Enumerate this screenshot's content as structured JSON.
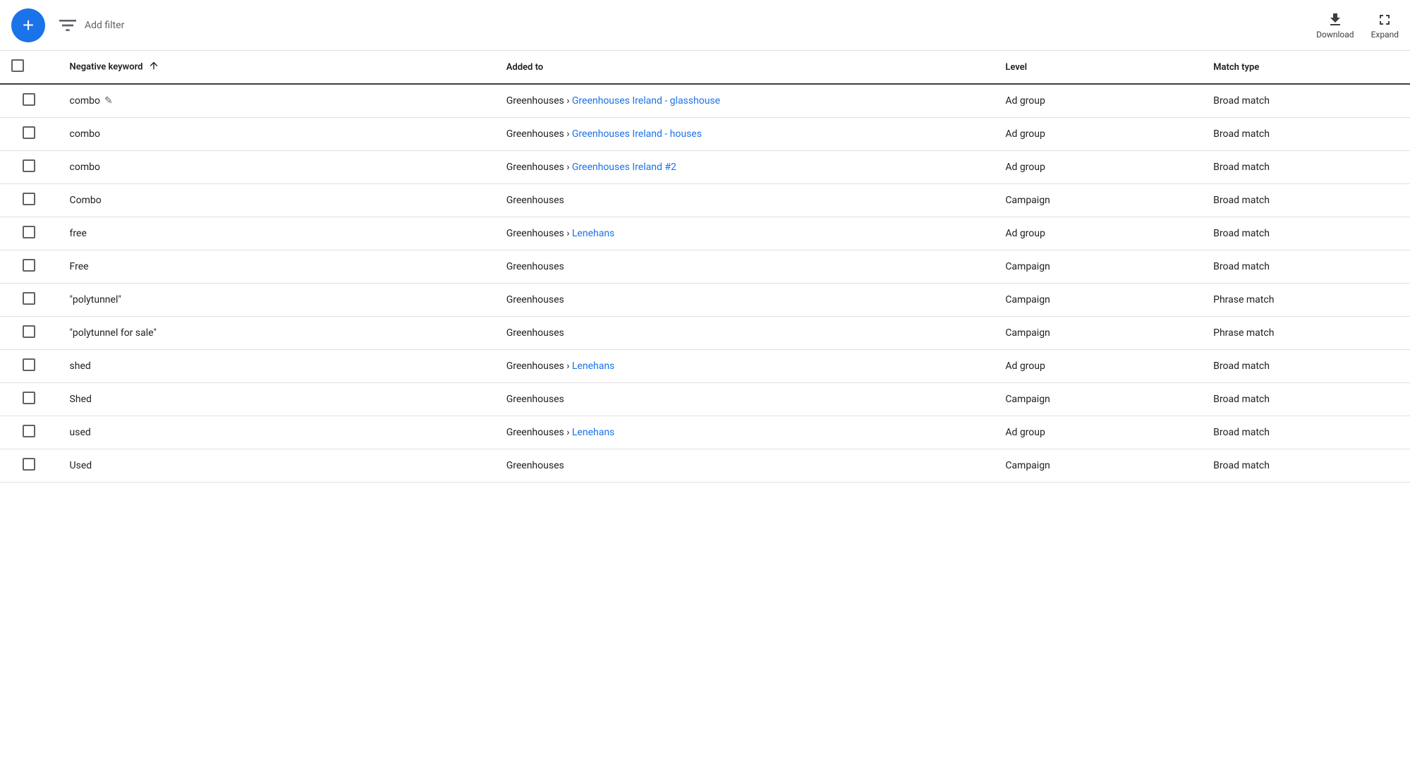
{
  "toolbar": {
    "add_button_label": "+",
    "filter_label": "Add filter",
    "download_label": "Download",
    "expand_label": "Expand"
  },
  "table": {
    "columns": [
      {
        "id": "checkbox",
        "label": ""
      },
      {
        "id": "keyword",
        "label": "Negative keyword",
        "sortable": true
      },
      {
        "id": "added_to",
        "label": "Added to"
      },
      {
        "id": "level",
        "label": "Level"
      },
      {
        "id": "match_type",
        "label": "Match type"
      }
    ],
    "rows": [
      {
        "keyword": "combo",
        "has_edit": true,
        "added_to_prefix": "Greenhouses › ",
        "added_to_link": "Greenhouses Ireland - glasshouse",
        "added_to_text": "Greenhouses › Greenhouses Ireland - glasshouse",
        "level": "Ad group",
        "match_type": "Broad match"
      },
      {
        "keyword": "combo",
        "has_edit": false,
        "added_to_prefix": "Greenhouses › ",
        "added_to_link": "Greenhouses Ireland - houses",
        "added_to_text": "Greenhouses › Greenhouses Ireland - houses",
        "level": "Ad group",
        "match_type": "Broad match"
      },
      {
        "keyword": "combo",
        "has_edit": false,
        "added_to_prefix": "Greenhouses › ",
        "added_to_link": "Greenhouses Ireland #2",
        "added_to_text": "Greenhouses › Greenhouses Ireland #2",
        "level": "Ad group",
        "match_type": "Broad match"
      },
      {
        "keyword": "Combo",
        "has_edit": false,
        "added_to_prefix": "",
        "added_to_link": "",
        "added_to_text": "Greenhouses",
        "level": "Campaign",
        "match_type": "Broad match"
      },
      {
        "keyword": "free",
        "has_edit": false,
        "added_to_prefix": "Greenhouses › ",
        "added_to_link": "Lenehans",
        "added_to_text": "Greenhouses › Lenehans",
        "level": "Ad group",
        "match_type": "Broad match"
      },
      {
        "keyword": "Free",
        "has_edit": false,
        "added_to_prefix": "",
        "added_to_link": "",
        "added_to_text": "Greenhouses",
        "level": "Campaign",
        "match_type": "Broad match"
      },
      {
        "keyword": "\"polytunnel\"",
        "has_edit": false,
        "added_to_prefix": "",
        "added_to_link": "",
        "added_to_text": "Greenhouses",
        "level": "Campaign",
        "match_type": "Phrase match"
      },
      {
        "keyword": "\"polytunnel for sale\"",
        "has_edit": false,
        "added_to_prefix": "",
        "added_to_link": "",
        "added_to_text": "Greenhouses",
        "level": "Campaign",
        "match_type": "Phrase match"
      },
      {
        "keyword": "shed",
        "has_edit": false,
        "added_to_prefix": "Greenhouses › ",
        "added_to_link": "Lenehans",
        "added_to_text": "Greenhouses › Lenehans",
        "level": "Ad group",
        "match_type": "Broad match"
      },
      {
        "keyword": "Shed",
        "has_edit": false,
        "added_to_prefix": "",
        "added_to_link": "",
        "added_to_text": "Greenhouses",
        "level": "Campaign",
        "match_type": "Broad match"
      },
      {
        "keyword": "used",
        "has_edit": false,
        "added_to_prefix": "Greenhouses › ",
        "added_to_link": "Lenehans",
        "added_to_text": "Greenhouses › Lenehans",
        "level": "Ad group",
        "match_type": "Broad match"
      },
      {
        "keyword": "Used",
        "has_edit": false,
        "added_to_prefix": "",
        "added_to_link": "",
        "added_to_text": "Greenhouses",
        "level": "Campaign",
        "match_type": "Broad match"
      }
    ]
  }
}
